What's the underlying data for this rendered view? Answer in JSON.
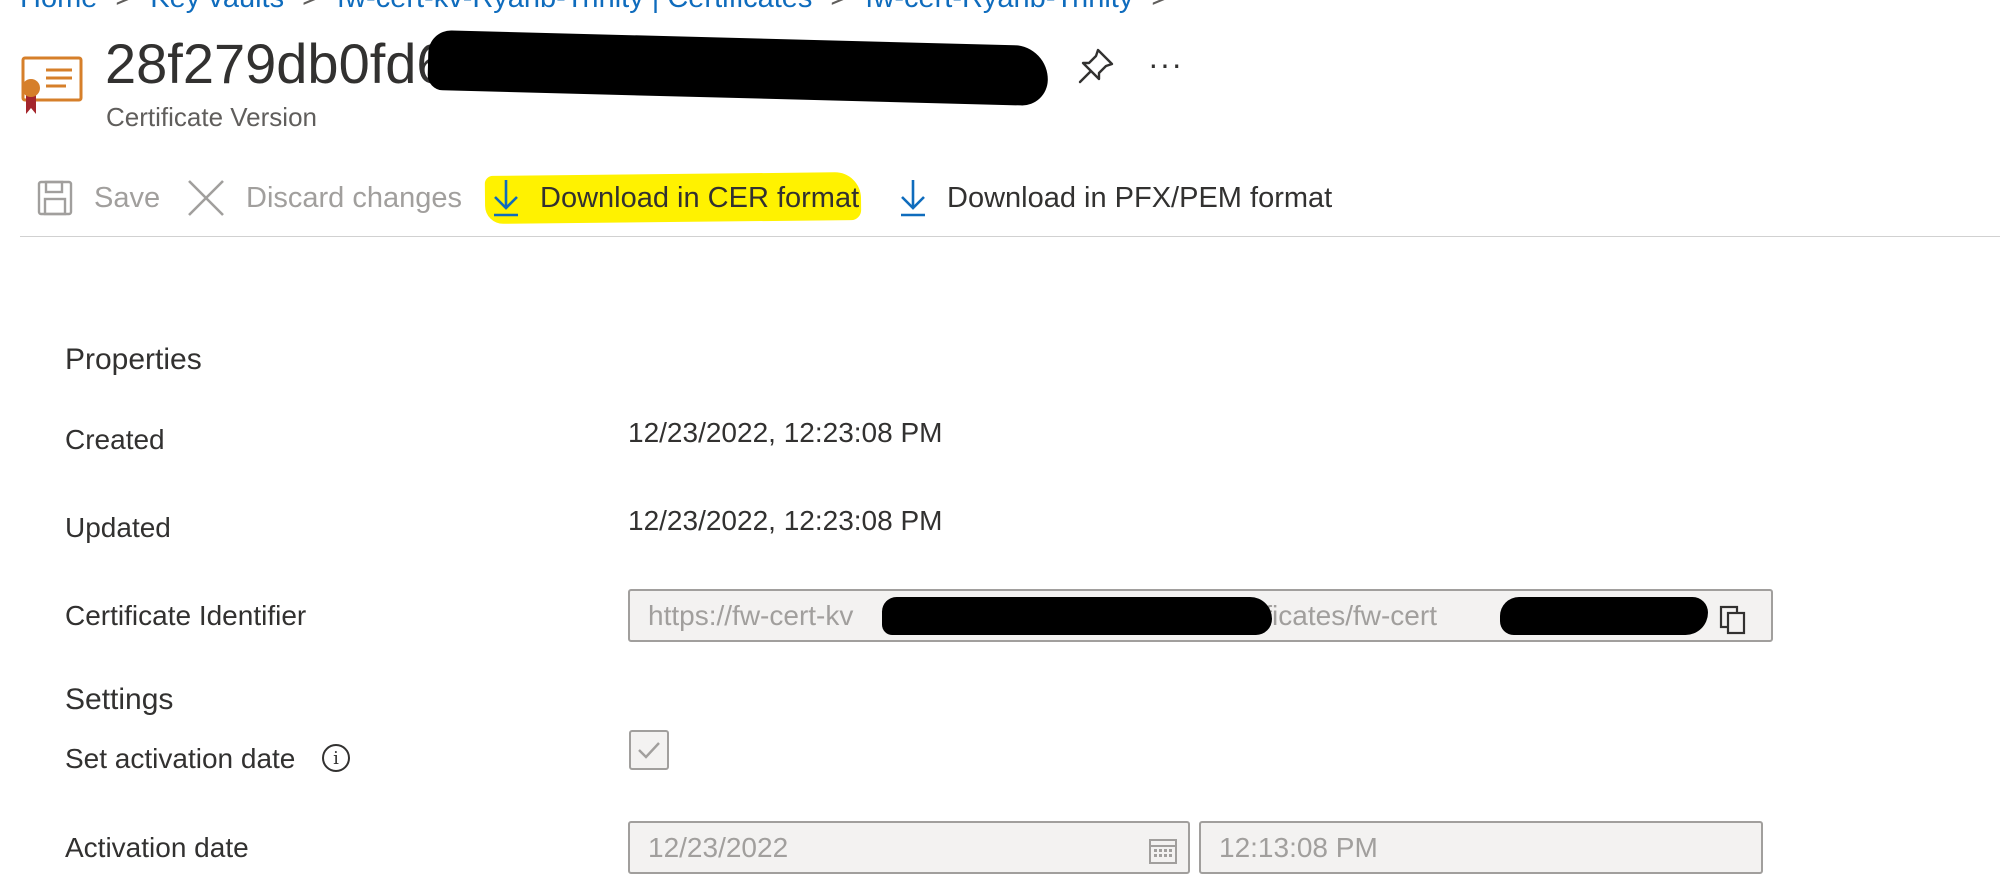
{
  "breadcrumb": {
    "items": [
      "Home",
      "Key vaults",
      "fw-cert-kv-Ryanb-Trinity | Certificates",
      "fw-cert-Ryanb-Trinity"
    ],
    "separator": ">"
  },
  "header": {
    "title": "28f279db0fd6",
    "subtitle": "Certificate Version",
    "more_label": "···"
  },
  "toolbar": {
    "save_label": "Save",
    "discard_label": "Discard changes",
    "download_cer_label": "Download in CER format",
    "download_pfx_label": "Download in PFX/PEM format"
  },
  "properties": {
    "header": "Properties",
    "created_label": "Created",
    "created_value": "12/23/2022, 12:23:08 PM",
    "updated_label": "Updated",
    "updated_value": "12/23/2022, 12:23:08 PM",
    "identifier_label": "Certificate Identifier",
    "identifier_value_start": "https://fw-cert-kv",
    "identifier_value_mid": "certificates/fw-cert"
  },
  "settings": {
    "header": "Settings",
    "activation_label": "Set activation date",
    "activation_checked": true,
    "activation_date_label": "Activation date",
    "activation_date_value": "12/23/2022",
    "activation_time_value": "12:13:08 PM"
  },
  "colors": {
    "accent": "#0f6cbd",
    "highlight": "#fff200",
    "disabled": "#a19f9d",
    "icon_orange": "#d67f2a",
    "ribbon_red": "#a4262c"
  }
}
